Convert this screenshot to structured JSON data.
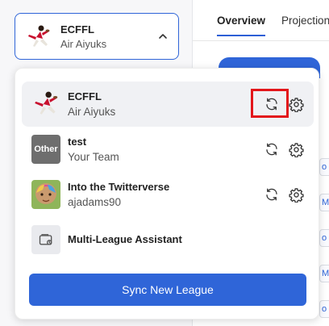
{
  "tabs": [
    {
      "label": "Overview",
      "active": true
    },
    {
      "label": "Projections",
      "active": false
    }
  ],
  "selector": {
    "title": "ECFFL",
    "subtitle": "Air Aiyuks"
  },
  "leagues": [
    {
      "title": "ECFFL",
      "subtitle": "Air Aiyuks",
      "avatar": "player-photo",
      "selected": true,
      "highlighted_action": "refresh"
    },
    {
      "title": "test",
      "subtitle": "Your Team",
      "avatar_text": "Other",
      "selected": false
    },
    {
      "title": "Into the Twitterverse",
      "subtitle": "ajadams90",
      "avatar": "user-avatar-photo",
      "selected": false
    }
  ],
  "assistant": {
    "title": "Multi-League Assistant"
  },
  "sync_button": {
    "label": "Sync New League"
  },
  "colors": {
    "accent": "#2f65d8",
    "highlight": "#e3161b",
    "selected_row": "#f0f1f4"
  }
}
